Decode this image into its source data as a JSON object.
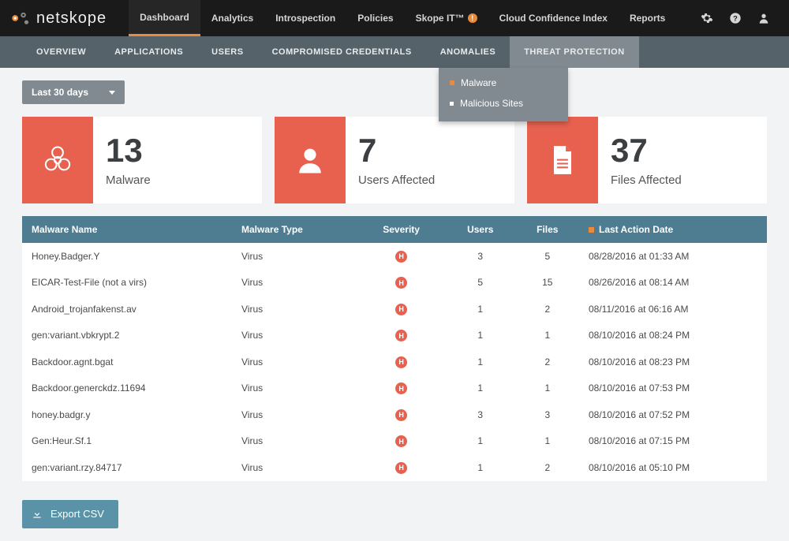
{
  "brand": {
    "name": "netskope"
  },
  "topnav": {
    "items": [
      "Dashboard",
      "Analytics",
      "Introspection",
      "Policies",
      "Skope IT™",
      "Cloud Confidence Index",
      "Reports"
    ],
    "active_index": 0,
    "alert_index": 4
  },
  "subnav": {
    "items": [
      "OVERVIEW",
      "APPLICATIONS",
      "USERS",
      "COMPROMISED CREDENTIALS",
      "ANOMALIES",
      "THREAT PROTECTION"
    ],
    "active_index": 5,
    "submenu": {
      "items": [
        "Malware",
        "Malicious Sites"
      ],
      "active_index": 0
    }
  },
  "toolbar": {
    "daterange_label": "Last 30 days"
  },
  "cards": [
    {
      "value": "13",
      "label": "Malware",
      "icon": "biohazard"
    },
    {
      "value": "7",
      "label": "Users Affected",
      "icon": "user"
    },
    {
      "value": "37",
      "label": "Files Affected",
      "icon": "file"
    }
  ],
  "table": {
    "columns": [
      "Malware Name",
      "Malware Type",
      "Severity",
      "Users",
      "Files",
      "Last Action Date"
    ],
    "sort_column_index": 5,
    "rows": [
      {
        "name": "Honey.Badger.Y",
        "type": "Virus",
        "severity": "H",
        "users": "3",
        "files": "5",
        "date": "08/28/2016 at 01:33 AM"
      },
      {
        "name": "EICAR-Test-File (not a virs)",
        "type": "Virus",
        "severity": "H",
        "users": "5",
        "files": "15",
        "date": "08/26/2016 at 08:14 AM"
      },
      {
        "name": "Android_trojanfakenst.av",
        "type": "Virus",
        "severity": "H",
        "users": "1",
        "files": "2",
        "date": "08/11/2016 at 06:16 AM"
      },
      {
        "name": "gen:variant.vbkrypt.2",
        "type": "Virus",
        "severity": "H",
        "users": "1",
        "files": "1",
        "date": "08/10/2016 at 08:24 PM"
      },
      {
        "name": "Backdoor.agnt.bgat",
        "type": "Virus",
        "severity": "H",
        "users": "1",
        "files": "2",
        "date": "08/10/2016 at 08:23 PM"
      },
      {
        "name": "Backdoor.generckdz.11694",
        "type": "Virus",
        "severity": "H",
        "users": "1",
        "files": "1",
        "date": "08/10/2016 at 07:53 PM"
      },
      {
        "name": "honey.badgr.y",
        "type": "Virus",
        "severity": "H",
        "users": "3",
        "files": "3",
        "date": "08/10/2016 at 07:52 PM"
      },
      {
        "name": "Gen:Heur.Sf.1",
        "type": "Virus",
        "severity": "H",
        "users": "1",
        "files": "1",
        "date": "08/10/2016 at 07:15 PM"
      },
      {
        "name": "gen:variant.rzy.84717",
        "type": "Virus",
        "severity": "H",
        "users": "1",
        "files": "2",
        "date": "08/10/2016 at 05:10 PM"
      }
    ]
  },
  "footer": {
    "export_label": "Export CSV"
  },
  "colors": {
    "accent": "#e98b3a",
    "danger": "#e8614f",
    "tablehead": "#4e7d91"
  }
}
